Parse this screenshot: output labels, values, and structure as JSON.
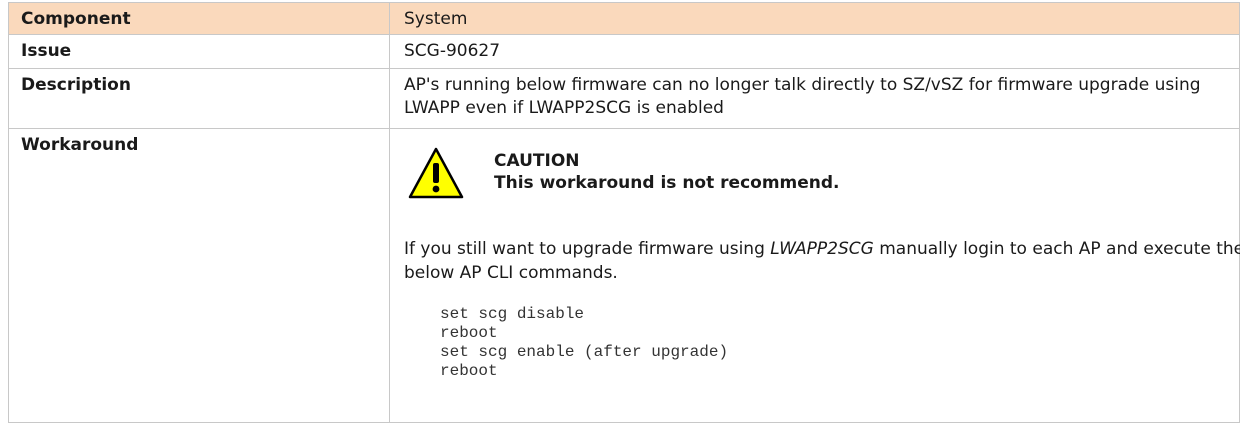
{
  "rows": {
    "component": {
      "label": "Component",
      "value": "System"
    },
    "issue": {
      "label": "Issue",
      "value": "SCG-90627"
    },
    "description": {
      "label": "Description",
      "value": "AP's running below firmware can no longer talk directly to SZ/vSZ for firmware upgrade using LWAPP even if LWAPP2SCG is enabled"
    },
    "workaround": {
      "label": "Workaround",
      "caution_title": "CAUTION",
      "caution_text": "This workaround is not recommend.",
      "para_before": "If you still want to upgrade firmware using ",
      "para_italic": "LWAPP2SCG",
      "para_after": " manually login to each AP and execute the below AP CLI commands.",
      "commands": [
        "set scg disable",
        "reboot",
        "set scg enable (after upgrade)",
        "reboot"
      ]
    }
  },
  "colors": {
    "header_bg": "#fad9bc",
    "border": "#c8c8c8",
    "warning_yellow": "#ffff00"
  },
  "icons": {
    "caution": "warning-triangle-icon"
  }
}
